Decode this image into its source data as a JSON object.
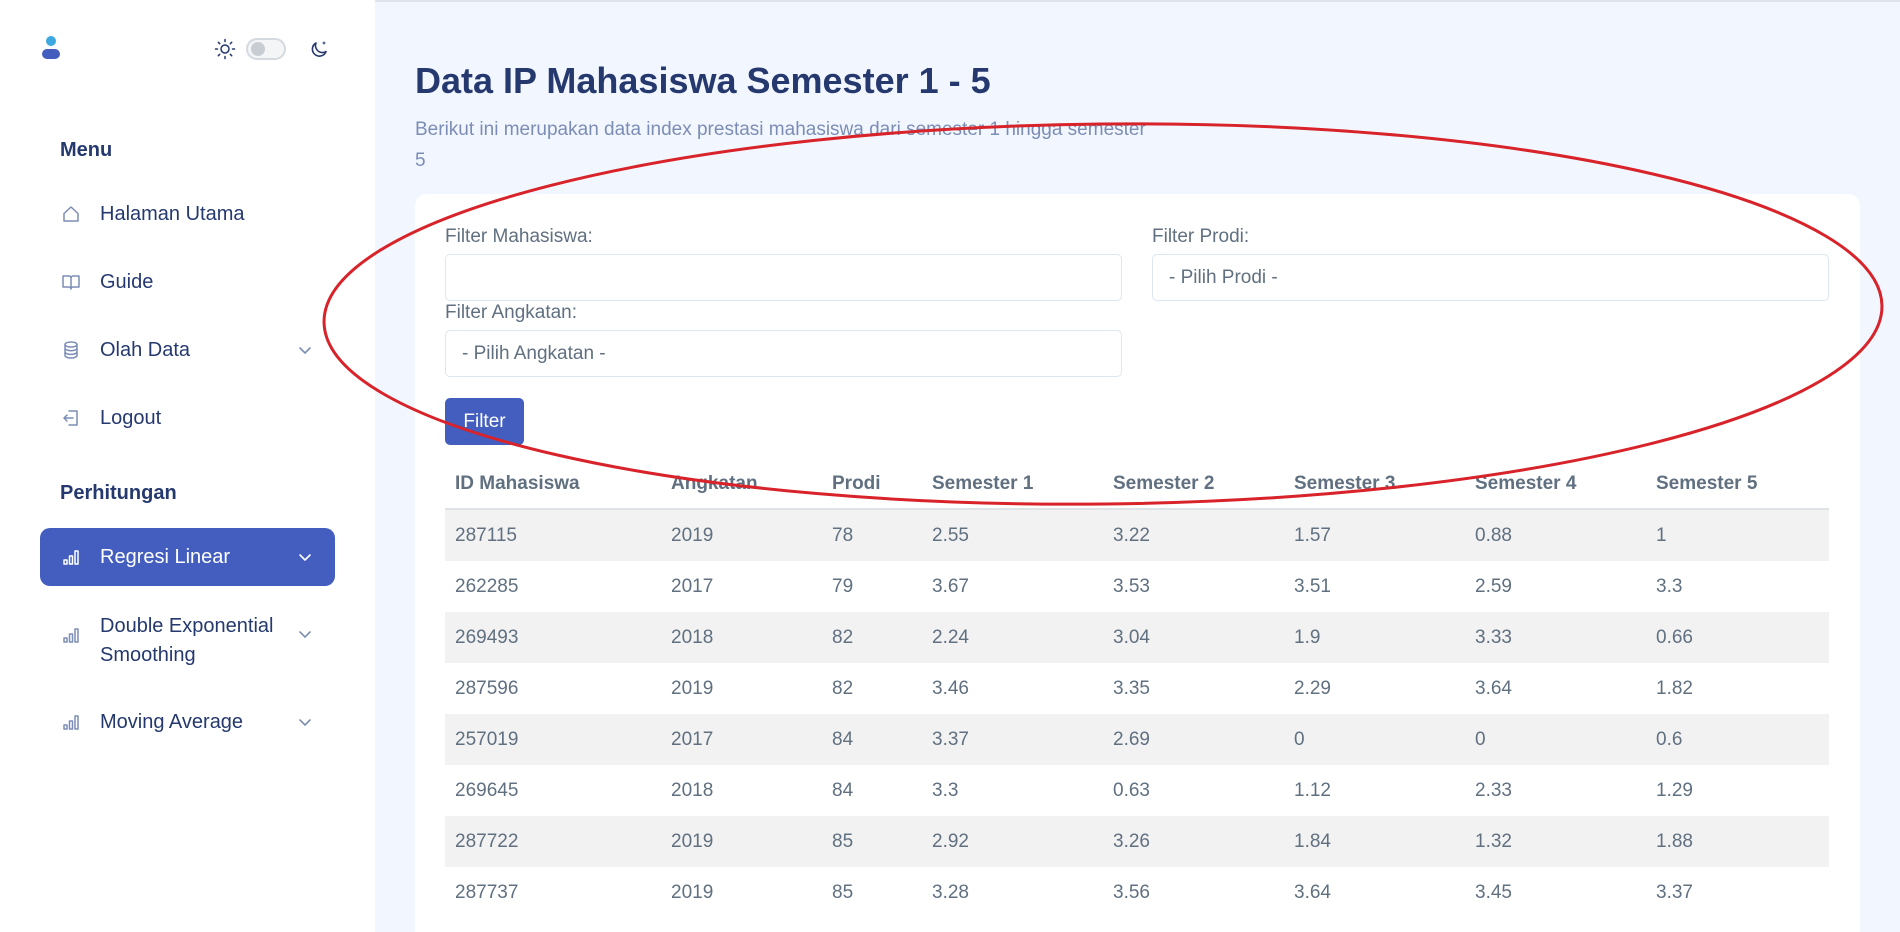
{
  "sidebar": {
    "menu_title": "Menu",
    "items": [
      {
        "label": "Halaman Utama",
        "icon": "home-icon"
      },
      {
        "label": "Guide",
        "icon": "book-icon"
      },
      {
        "label": "Olah Data",
        "icon": "database-icon"
      },
      {
        "label": "Logout",
        "icon": "logout-icon"
      }
    ],
    "section_title": "Perhitungan",
    "calc_items": [
      {
        "label": "Regresi Linear",
        "icon": "bar-chart-icon",
        "active": true
      },
      {
        "label": "Double Exponential Smoothing",
        "icon": "bar-chart-icon"
      },
      {
        "label": "Moving Average",
        "icon": "bar-chart-icon"
      }
    ],
    "theme_toggle": {
      "light_icon": "sun-icon",
      "dark_icon": "moon-icon"
    }
  },
  "main": {
    "title": "Data IP Mahasiswa Semester 1 - 5",
    "subtitle": "Berikut ini merupakan data index prestasi mahasiswa dari semester 1 hingga semester 5",
    "filters": {
      "mahasiswa_label": "Filter Mahasiswa:",
      "mahasiswa_value": "",
      "prodi_label": "Filter Prodi:",
      "prodi_value": "- Pilih Prodi -",
      "angkatan_label": "Filter Angkatan:",
      "angkatan_value": "- Pilih Angkatan -",
      "button": "Filter"
    },
    "table": {
      "headers": [
        "ID Mahasiswa",
        "Angkatan",
        "Prodi",
        "Semester 1",
        "Semester 2",
        "Semester 3",
        "Semester 4",
        "Semester 5"
      ],
      "rows": [
        [
          "287115",
          "2019",
          "78",
          "2.55",
          "3.22",
          "1.57",
          "0.88",
          "1"
        ],
        [
          "262285",
          "2017",
          "79",
          "3.67",
          "3.53",
          "3.51",
          "2.59",
          "3.3"
        ],
        [
          "269493",
          "2018",
          "82",
          "2.24",
          "3.04",
          "1.9",
          "3.33",
          "0.66"
        ],
        [
          "287596",
          "2019",
          "82",
          "3.46",
          "3.35",
          "2.29",
          "3.64",
          "1.82"
        ],
        [
          "257019",
          "2017",
          "84",
          "3.37",
          "2.69",
          "0",
          "0",
          "0.6"
        ],
        [
          "269645",
          "2018",
          "84",
          "3.3",
          "0.63",
          "1.12",
          "2.33",
          "1.29"
        ],
        [
          "287722",
          "2019",
          "85",
          "2.92",
          "3.26",
          "1.84",
          "1.32",
          "1.88"
        ],
        [
          "287737",
          "2019",
          "85",
          "3.28",
          "3.56",
          "3.64",
          "3.45",
          "3.37"
        ]
      ]
    }
  },
  "colors": {
    "primary": "#435ebe",
    "text_dark": "#25396f",
    "text_muted": "#607080",
    "annotation": "#d8232a",
    "background": "#f2f7ff"
  }
}
